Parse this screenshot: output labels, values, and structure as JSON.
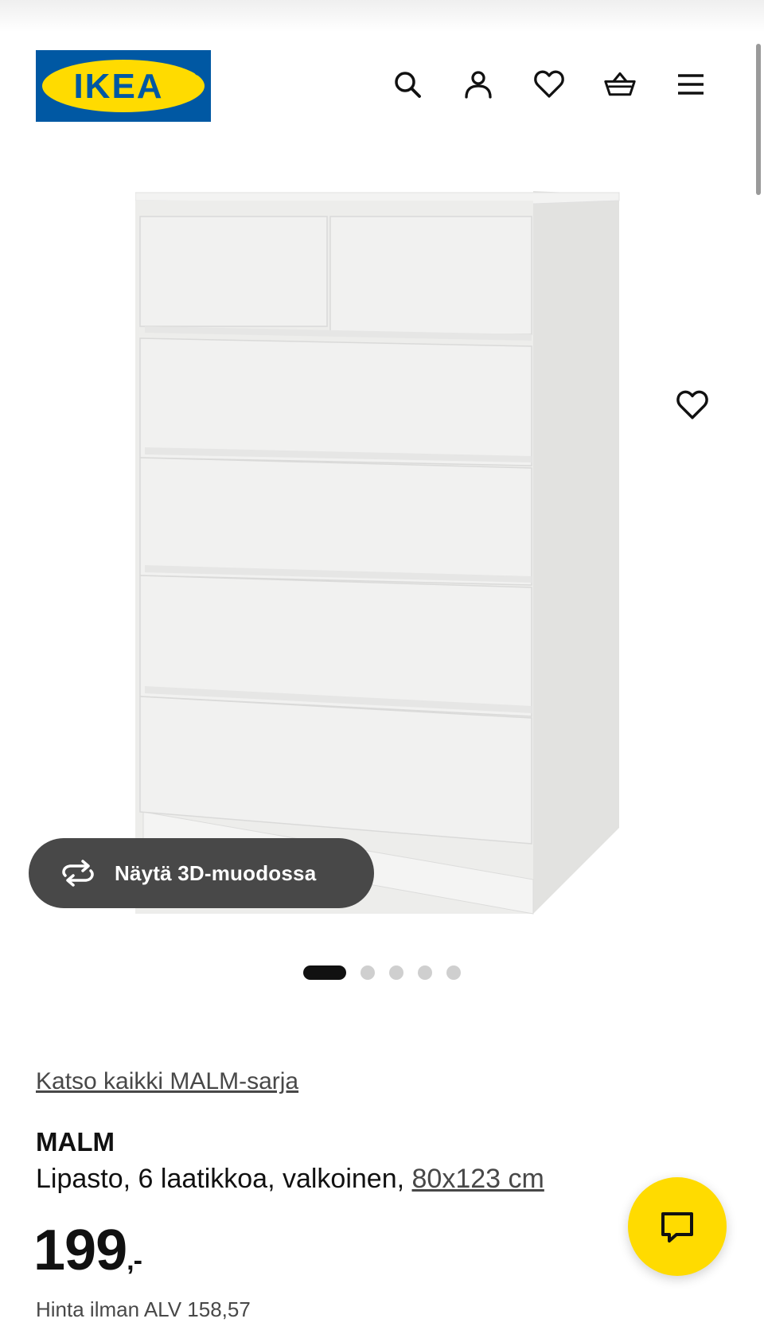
{
  "header": {
    "logo_text": "IKEA",
    "icons": [
      "search-icon",
      "user-icon",
      "heart-icon",
      "basket-icon",
      "menu-icon"
    ]
  },
  "gallery": {
    "image_name": "malm-chest-of-drawers",
    "view_3d_label": "Näytä 3D-muodossa",
    "image_count": 5,
    "active_index": 0
  },
  "product": {
    "series_link": "Katso kaikki MALM-sarja",
    "name": "MALM",
    "description": "Lipasto, 6 laatikkoa, valkoinen, ",
    "size": "80x123 cm",
    "price": "199",
    "price_suffix": ",-",
    "price_without_vat": "Hinta ilman ALV 158,57"
  },
  "colors": {
    "brand_blue": "#0058a3",
    "brand_yellow": "#ffdb00",
    "dark_button": "#484848"
  }
}
